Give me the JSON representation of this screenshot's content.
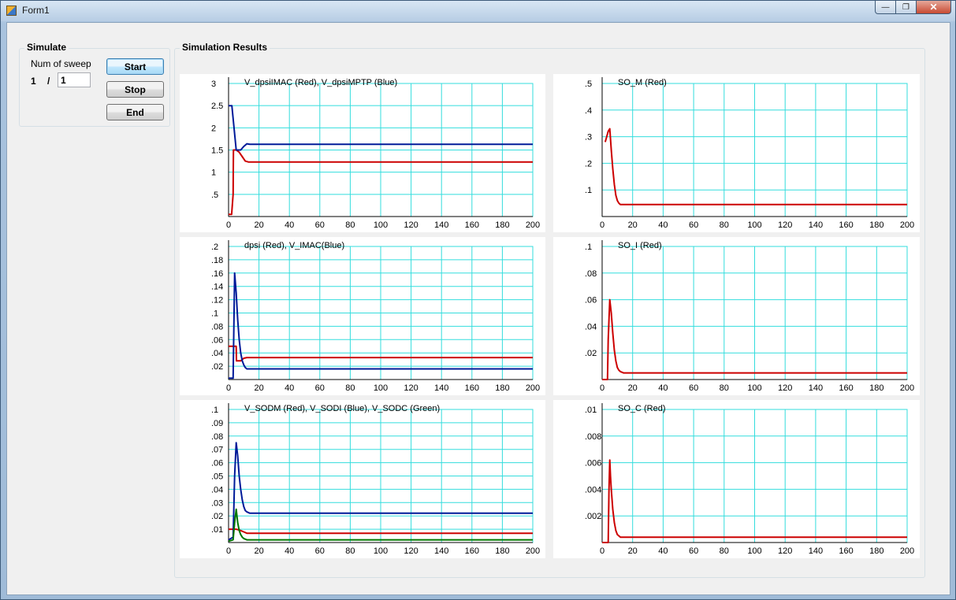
{
  "window": {
    "title": "Form1",
    "min": "—",
    "max": "❐",
    "close": "✕"
  },
  "simulate": {
    "group_label": "Simulate",
    "sweep_label": "Num of sweep",
    "current_sweep": "1",
    "separator": "/",
    "sweep_input_value": "1",
    "start_label": "Start",
    "stop_label": "Stop",
    "end_label": "End"
  },
  "results": {
    "group_label": "Simulation Results"
  },
  "colors": {
    "grid": "#33dddd",
    "red": "#cc0000",
    "blue": "#001a99",
    "green": "#007700"
  },
  "chart_data": [
    {
      "type": "line",
      "title": "V_dpsiIMAC (Red), V_dpsiMPTP (Blue)",
      "xlim": [
        0,
        200
      ],
      "ylim": [
        0,
        3
      ],
      "xticks": [
        0,
        20,
        40,
        60,
        80,
        100,
        120,
        140,
        160,
        180,
        200
      ],
      "xtick_labels": [
        "0",
        "20",
        "40",
        "60",
        "80",
        "100",
        "120",
        "140",
        "160",
        "180",
        "200"
      ],
      "yticks": [
        0.5,
        1,
        1.5,
        2,
        2.5,
        3
      ],
      "ytick_labels": [
        ".5",
        "1",
        "1.5",
        "2",
        "2.5",
        "3"
      ],
      "grid": true,
      "series": [
        {
          "color": "red",
          "x": [
            0,
            2,
            3,
            3.2,
            5,
            7,
            9,
            11,
            13,
            200
          ],
          "y": [
            0.05,
            0.05,
            0.5,
            1.5,
            1.5,
            1.45,
            1.35,
            1.25,
            1.23,
            1.23
          ]
        },
        {
          "color": "blue",
          "x": [
            0,
            2,
            2.2,
            5,
            8,
            10,
            12,
            14,
            200
          ],
          "y": [
            2.5,
            2.5,
            2.5,
            1.5,
            1.5,
            1.58,
            1.64,
            1.63,
            1.63
          ]
        }
      ]
    },
    {
      "type": "line",
      "title": "SO_M (Red)",
      "xlim": [
        0,
        200
      ],
      "ylim": [
        0,
        0.5
      ],
      "xticks": [
        0,
        20,
        40,
        60,
        80,
        100,
        120,
        140,
        160,
        180,
        200
      ],
      "xtick_labels": [
        "0",
        "20",
        "40",
        "60",
        "80",
        "100",
        "120",
        "140",
        "160",
        "180",
        "200"
      ],
      "yticks": [
        0.1,
        0.2,
        0.3,
        0.4,
        0.5
      ],
      "ytick_labels": [
        ".1",
        ".2",
        ".3",
        ".4",
        ".5"
      ],
      "grid": true,
      "series": [
        {
          "color": "red",
          "x": [
            2,
            3,
            4,
            5,
            6,
            7,
            8,
            9,
            10,
            11,
            12,
            14,
            200
          ],
          "y": [
            0.28,
            0.3,
            0.32,
            0.33,
            0.25,
            0.18,
            0.12,
            0.08,
            0.06,
            0.05,
            0.045,
            0.045,
            0.045
          ]
        }
      ]
    },
    {
      "type": "line",
      "title": "dpsi (Red), V_IMAC(Blue)",
      "xlim": [
        0,
        200
      ],
      "ylim": [
        0,
        0.2
      ],
      "xticks": [
        0,
        20,
        40,
        60,
        80,
        100,
        120,
        140,
        160,
        180,
        200
      ],
      "xtick_labels": [
        "0",
        "20",
        "40",
        "60",
        "80",
        "100",
        "120",
        "140",
        "160",
        "180",
        "200"
      ],
      "yticks": [
        0.02,
        0.04,
        0.06,
        0.08,
        0.1,
        0.12,
        0.14,
        0.16,
        0.18,
        0.2
      ],
      "ytick_labels": [
        ".02",
        ".04",
        ".06",
        ".08",
        ".1",
        ".12",
        ".14",
        ".16",
        ".18",
        ".2"
      ],
      "grid": true,
      "series": [
        {
          "color": "red",
          "x": [
            0,
            2,
            2.2,
            5,
            5.2,
            8,
            10,
            12,
            200
          ],
          "y": [
            0.05,
            0.05,
            0.05,
            0.05,
            0.028,
            0.028,
            0.032,
            0.033,
            0.033
          ]
        },
        {
          "color": "blue",
          "x": [
            0,
            3,
            4,
            5,
            6,
            7,
            8,
            9,
            10,
            11,
            12,
            14,
            200
          ],
          "y": [
            0.002,
            0.002,
            0.16,
            0.13,
            0.09,
            0.06,
            0.04,
            0.028,
            0.022,
            0.018,
            0.016,
            0.016,
            0.016
          ]
        }
      ]
    },
    {
      "type": "line",
      "title": "SO_I (Red)",
      "xlim": [
        0,
        200
      ],
      "ylim": [
        0,
        0.1
      ],
      "xticks": [
        0,
        20,
        40,
        60,
        80,
        100,
        120,
        140,
        160,
        180,
        200
      ],
      "xtick_labels": [
        "0",
        "20",
        "40",
        "60",
        "80",
        "100",
        "120",
        "140",
        "160",
        "180",
        "200"
      ],
      "yticks": [
        0.02,
        0.04,
        0.06,
        0.08,
        0.1
      ],
      "ytick_labels": [
        ".02",
        ".04",
        ".06",
        ".08",
        ".1"
      ],
      "grid": true,
      "series": [
        {
          "color": "red",
          "x": [
            0,
            3.5,
            4,
            5,
            6,
            7,
            8,
            9,
            10,
            11,
            12,
            14,
            200
          ],
          "y": [
            0,
            0,
            0.03,
            0.06,
            0.05,
            0.035,
            0.022,
            0.014,
            0.009,
            0.007,
            0.006,
            0.005,
            0.005
          ]
        }
      ]
    },
    {
      "type": "line",
      "title": "V_SODM (Red), V_SODI (Blue), V_SODC (Green)",
      "xlim": [
        0,
        200
      ],
      "ylim": [
        0,
        0.1
      ],
      "xticks": [
        0,
        20,
        40,
        60,
        80,
        100,
        120,
        140,
        160,
        180,
        200
      ],
      "xtick_labels": [
        "0",
        "20",
        "40",
        "60",
        "80",
        "100",
        "120",
        "140",
        "160",
        "180",
        "200"
      ],
      "yticks": [
        0.01,
        0.02,
        0.03,
        0.04,
        0.05,
        0.06,
        0.07,
        0.08,
        0.09,
        0.1
      ],
      "ytick_labels": [
        ".01",
        ".02",
        ".03",
        ".04",
        ".05",
        ".06",
        ".07",
        ".08",
        ".09",
        ".1"
      ],
      "grid": true,
      "series": [
        {
          "color": "red",
          "x": [
            0,
            2,
            5,
            8,
            10,
            12,
            14,
            200
          ],
          "y": [
            0.01,
            0.01,
            0.01,
            0.009,
            0.008,
            0.007,
            0.007,
            0.007
          ]
        },
        {
          "color": "blue",
          "x": [
            0,
            3,
            4,
            5,
            6,
            7,
            8,
            9,
            10,
            11,
            12,
            14,
            200
          ],
          "y": [
            0.002,
            0.004,
            0.05,
            0.075,
            0.065,
            0.05,
            0.04,
            0.032,
            0.027,
            0.024,
            0.023,
            0.022,
            0.022
          ]
        },
        {
          "color": "green",
          "x": [
            0,
            3,
            4,
            5,
            6,
            7,
            8,
            9,
            10,
            12,
            14,
            200
          ],
          "y": [
            0.001,
            0.002,
            0.015,
            0.025,
            0.015,
            0.009,
            0.006,
            0.004,
            0.003,
            0.002,
            0.002,
            0.002
          ]
        }
      ]
    },
    {
      "type": "line",
      "title": "SO_C (Red)",
      "xlim": [
        0,
        200
      ],
      "ylim": [
        0,
        0.01
      ],
      "xticks": [
        0,
        20,
        40,
        60,
        80,
        100,
        120,
        140,
        160,
        180,
        200
      ],
      "xtick_labels": [
        "0",
        "20",
        "40",
        "60",
        "80",
        "100",
        "120",
        "140",
        "160",
        "180",
        "200"
      ],
      "yticks": [
        0.002,
        0.004,
        0.006,
        0.008,
        0.01
      ],
      "ytick_labels": [
        ".002",
        ".004",
        ".006",
        ".008",
        ".01"
      ],
      "grid": true,
      "series": [
        {
          "color": "red",
          "x": [
            0,
            4,
            4.5,
            5,
            5.5,
            6,
            7,
            8,
            9,
            10,
            11,
            12,
            14,
            200
          ],
          "y": [
            0,
            0,
            0.004,
            0.0062,
            0.005,
            0.004,
            0.0025,
            0.0015,
            0.0009,
            0.0006,
            0.0005,
            0.0004,
            0.0004,
            0.0004
          ]
        }
      ]
    }
  ]
}
